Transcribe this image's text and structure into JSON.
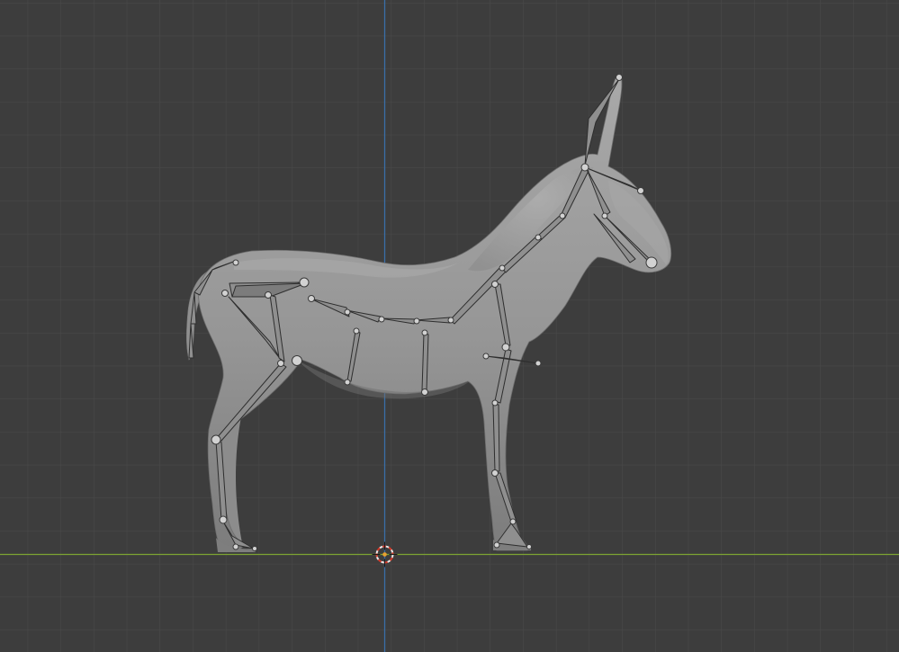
{
  "viewport": {
    "background": "#3d3d3d",
    "grid_minor": "#4a4a4a",
    "grid_major": "#545454",
    "axis_x_color": "#7da332",
    "axis_z_color": "#3a6fa8",
    "model_color": "#9a9a9a",
    "bone_color": "#8e8e8e"
  },
  "scene": {
    "object": "donkey-mesh",
    "armature": "armature-bones",
    "cursor": "3d-cursor-icon"
  }
}
